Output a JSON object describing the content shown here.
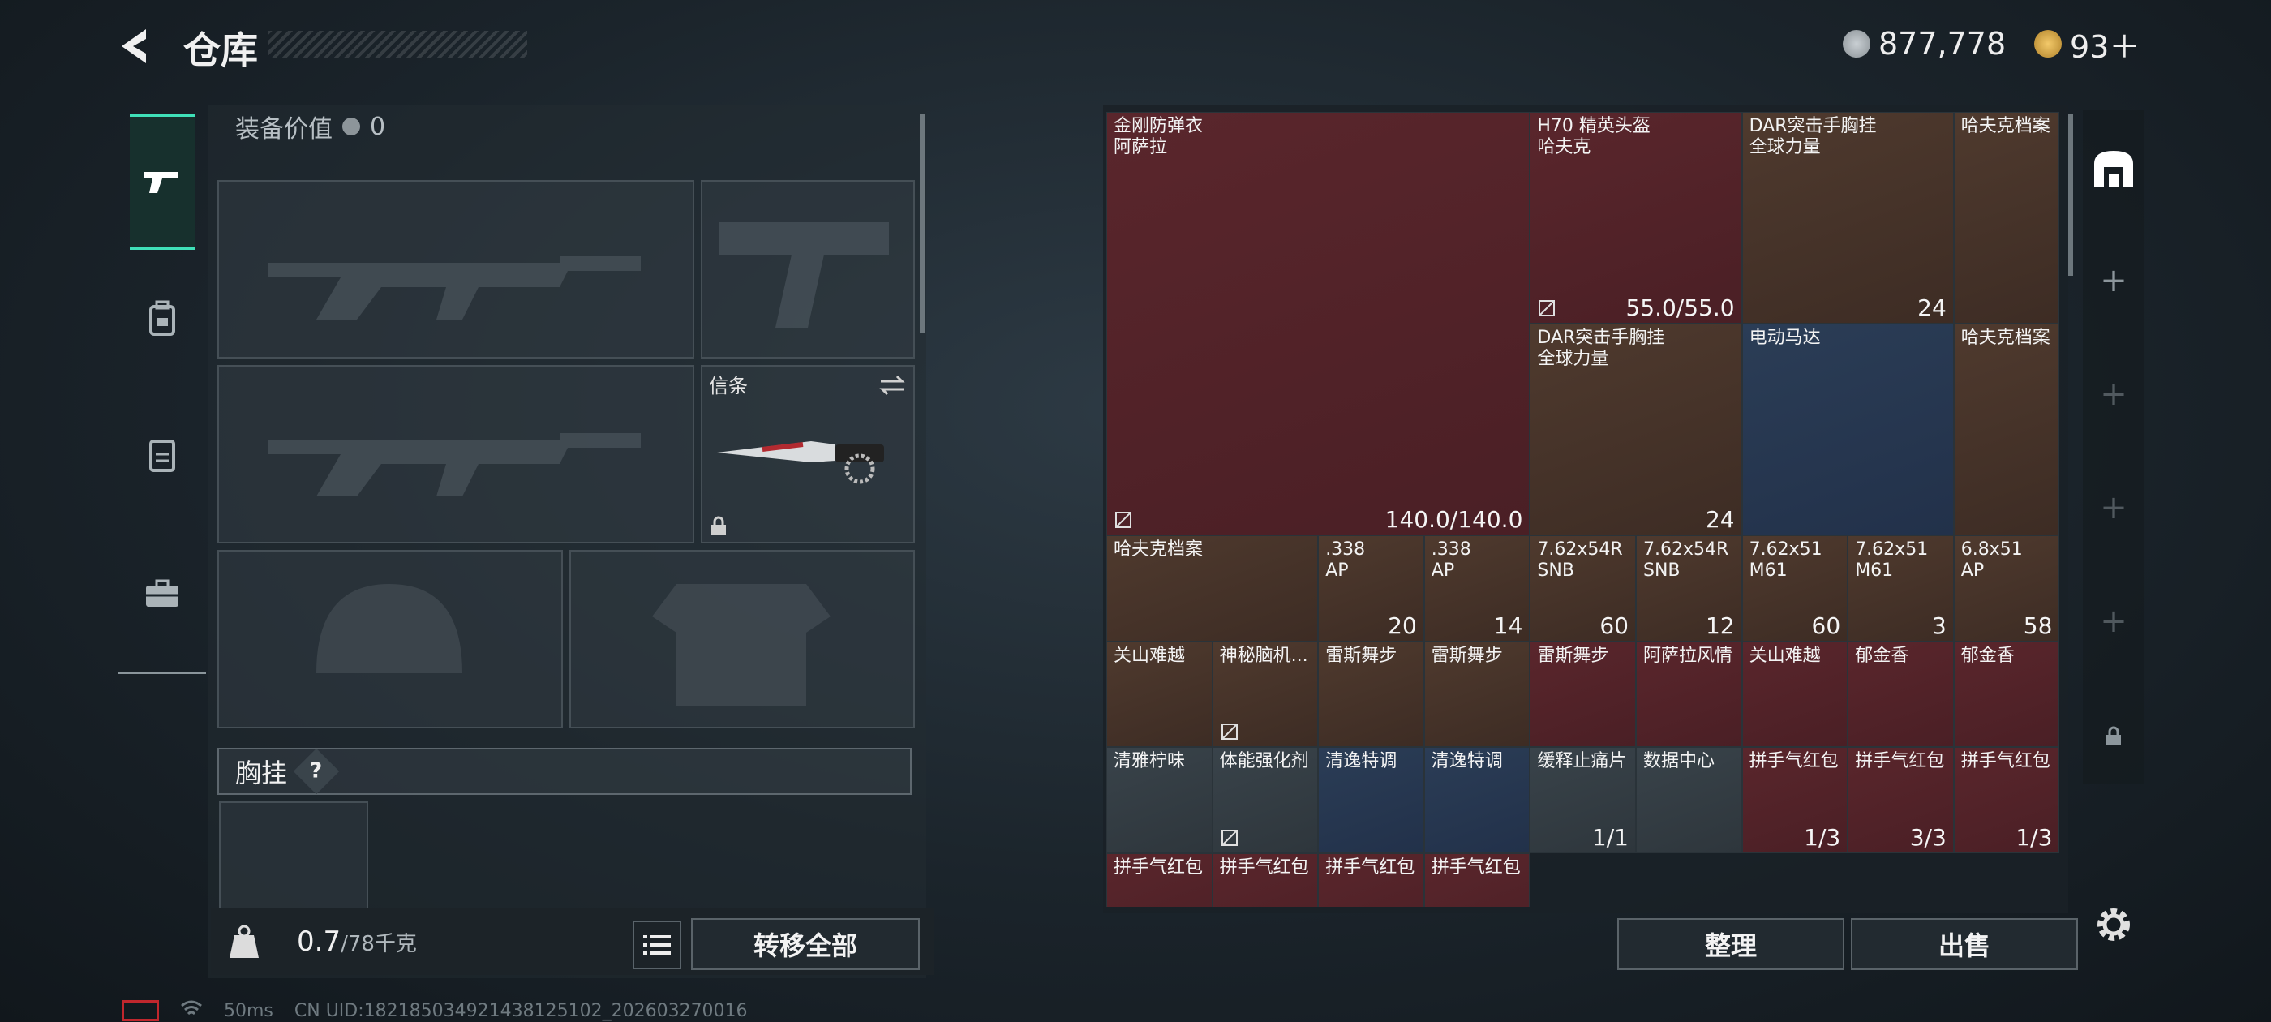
{
  "header": {
    "title": "仓库"
  },
  "currency": {
    "coins": "877,778",
    "gems": "93＋"
  },
  "left_tabs": [
    "weapon",
    "backpack",
    "vest",
    "case"
  ],
  "equipment": {
    "value_label": "装备价值",
    "value": "0",
    "knife_slot_label": "信条",
    "chest_label": "胸挂",
    "chest_help": "?"
  },
  "weight": {
    "current": "0.7",
    "max": "/78千克"
  },
  "buttons": {
    "transfer_all": "转移全部",
    "organize": "整理",
    "sell": "出售"
  },
  "warehouse": {
    "big": [
      {
        "name": "金刚防弹衣\n阿萨拉",
        "count": "140.0/140.0",
        "color": "red",
        "locked": true
      },
      {
        "name": "H70 精英头盔\n哈夫克",
        "count": "55.0/55.0",
        "color": "red",
        "locked": true
      },
      {
        "name": "DAR突击手胸挂\n全球力量",
        "count": "24",
        "color": "brown"
      },
      {
        "name": "哈夫克档案",
        "count": "",
        "color": "brown"
      },
      {
        "name": "DAR突击手胸挂\n全球力量",
        "count": "24",
        "color": "brown"
      },
      {
        "name": "电动马达",
        "count": "",
        "color": "blue"
      },
      {
        "name": "哈夫克档案",
        "count": "",
        "color": "brown"
      },
      {
        "name": "哈夫克档案",
        "count": "",
        "color": "brown"
      }
    ],
    "ammo": [
      {
        "name": ".338\nAP",
        "count": "20"
      },
      {
        "name": ".338\nAP",
        "count": "14"
      },
      {
        "name": "7.62x54R\nSNB",
        "count": "60"
      },
      {
        "name": "7.62x54R\nSNB",
        "count": "12"
      },
      {
        "name": "7.62x51\nM61",
        "count": "60"
      },
      {
        "name": "7.62x51\nM61",
        "count": "3"
      },
      {
        "name": "6.8x51\nAP",
        "count": "58"
      }
    ],
    "row4": [
      {
        "name": "关山难越",
        "count": "",
        "color": "brown"
      },
      {
        "name": "神秘脑机...",
        "count": "",
        "color": "brown",
        "locked": true
      },
      {
        "name": "雷斯舞步",
        "count": "",
        "color": "brown"
      },
      {
        "name": "雷斯舞步",
        "count": "",
        "color": "brown"
      },
      {
        "name": "雷斯舞步",
        "count": "",
        "color": "red"
      },
      {
        "name": "阿萨拉风情",
        "count": "",
        "color": "red"
      },
      {
        "name": "关山难越",
        "count": "",
        "color": "red"
      },
      {
        "name": "郁金香",
        "count": "",
        "color": "red"
      },
      {
        "name": "郁金香",
        "count": "",
        "color": "red"
      }
    ],
    "row5": [
      {
        "name": "清雅柠味",
        "count": "",
        "color": "grey"
      },
      {
        "name": "体能强化剂",
        "count": "",
        "color": "grey",
        "locked": true
      },
      {
        "name": "清逸特调",
        "count": "",
        "color": "blue"
      },
      {
        "name": "清逸特调",
        "count": "",
        "color": "blue"
      },
      {
        "name": "缓释止痛片",
        "count": "1/1",
        "color": "grey"
      },
      {
        "name": "数据中心",
        "count": "",
        "color": "grey"
      },
      {
        "name": "拼手气红包",
        "count": "1/3",
        "color": "red"
      },
      {
        "name": "拼手气红包",
        "count": "3/3",
        "color": "red"
      },
      {
        "name": "拼手气红包",
        "count": "1/3",
        "color": "red"
      }
    ],
    "row6": [
      "拼手气红包",
      "拼手气红包",
      "拼手气红包",
      "拼手气红包"
    ]
  },
  "status": {
    "ping": "50ms",
    "uid": "CN UID:182185034921438125102_202603270016"
  },
  "colors": {
    "accent": "#3fe0b8",
    "red_cell": "#5a262c",
    "brown_cell": "#4f3a2e",
    "blue_cell": "#2b3d56"
  }
}
